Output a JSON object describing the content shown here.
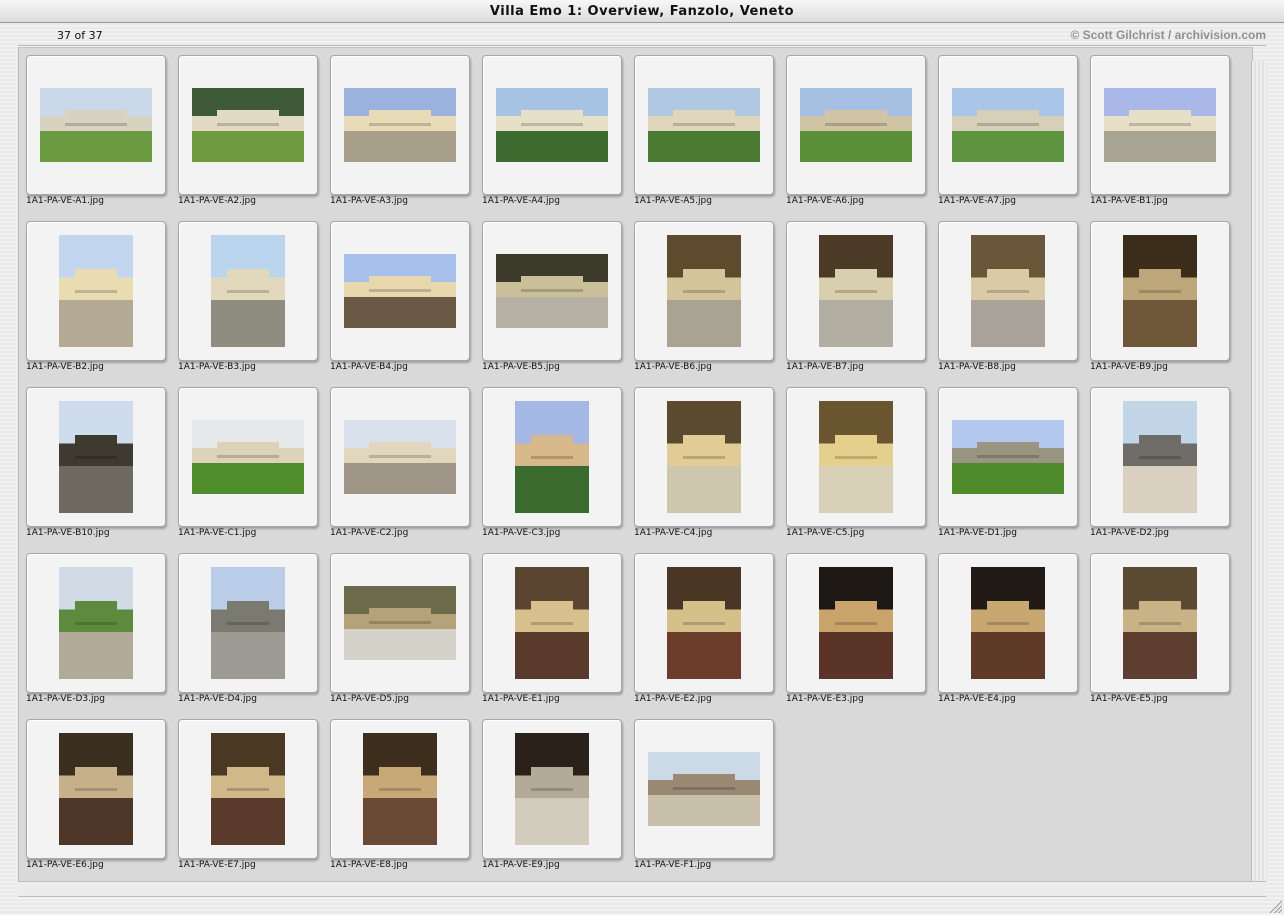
{
  "window": {
    "title": "Villa Emo 1: Overview, Fanzolo, Veneto",
    "counter": "37 of 37",
    "copyright": "© Scott Gilchrist / archivision.com"
  },
  "thumbnails": [
    {
      "file": "1A1-PA-VE-A1.jpg",
      "orientation": "landscape",
      "colors": [
        "#c9d9ea",
        "#d8d2c0",
        "#6c9a40"
      ]
    },
    {
      "file": "1A1-PA-VE-A2.jpg",
      "orientation": "landscape",
      "colors": [
        "#3e5a36",
        "#e2dac4",
        "#6f9b3e"
      ]
    },
    {
      "file": "1A1-PA-VE-A3.jpg",
      "orientation": "landscape",
      "colors": [
        "#9ab2dd",
        "#e7dbb8",
        "#a89f8a"
      ]
    },
    {
      "file": "1A1-PA-VE-A4.jpg",
      "orientation": "landscape",
      "colors": [
        "#a7c3e3",
        "#e7e0c8",
        "#3d6a2f"
      ]
    },
    {
      "file": "1A1-PA-VE-A5.jpg",
      "orientation": "landscape",
      "colors": [
        "#b0c8e2",
        "#e0d6bc",
        "#4b7a33"
      ]
    },
    {
      "file": "1A1-PA-VE-A6.jpg",
      "orientation": "landscape",
      "colors": [
        "#a6c0e3",
        "#cfc4a4",
        "#5b8f37"
      ]
    },
    {
      "file": "1A1-PA-VE-A7.jpg",
      "orientation": "landscape",
      "colors": [
        "#a9c6e8",
        "#d6d0b8",
        "#5e9340"
      ]
    },
    {
      "file": "1A1-PA-VE-B1.jpg",
      "orientation": "landscape",
      "colors": [
        "#a9b8e8",
        "#e7dfc6",
        "#a8a493"
      ]
    },
    {
      "file": "1A1-PA-VE-B2.jpg",
      "orientation": "portrait",
      "colors": [
        "#c2d7ef",
        "#e9dcb2",
        "#b5ab95"
      ]
    },
    {
      "file": "1A1-PA-VE-B3.jpg",
      "orientation": "portrait",
      "colors": [
        "#bcd5ef",
        "#e2d9bc",
        "#8f8c80"
      ]
    },
    {
      "file": "1A1-PA-VE-B4.jpg",
      "orientation": "landscape",
      "colors": [
        "#a8c0ee",
        "#e8d8ae",
        "#6a5a45"
      ]
    },
    {
      "file": "1A1-PA-VE-B5.jpg",
      "orientation": "landscape",
      "colors": [
        "#3c3a2a",
        "#c9c09a",
        "#b6b0a4"
      ]
    },
    {
      "file": "1A1-PA-VE-B6.jpg",
      "orientation": "portrait",
      "colors": [
        "#5e4a2c",
        "#d4c49a",
        "#a9a394"
      ]
    },
    {
      "file": "1A1-PA-VE-B7.jpg",
      "orientation": "portrait",
      "colors": [
        "#4a3a26",
        "#d8cfae",
        "#b3aea2"
      ]
    },
    {
      "file": "1A1-PA-VE-B8.jpg",
      "orientation": "portrait",
      "colors": [
        "#6a5638",
        "#d9cba6",
        "#a8a298"
      ]
    },
    {
      "file": "1A1-PA-VE-B9.jpg",
      "orientation": "portrait",
      "colors": [
        "#3c2c1a",
        "#bda67a",
        "#6d5738"
      ]
    },
    {
      "file": "1A1-PA-VE-B10.jpg",
      "orientation": "portrait",
      "colors": [
        "#cfdcec",
        "#3e3a30",
        "#6e6a62"
      ]
    },
    {
      "file": "1A1-PA-VE-C1.jpg",
      "orientation": "landscape",
      "colors": [
        "#e6e8ea",
        "#ddd3b8",
        "#4f8c2a"
      ]
    },
    {
      "file": "1A1-PA-VE-C2.jpg",
      "orientation": "landscape",
      "colors": [
        "#d9e2ec",
        "#e0d7bd",
        "#9f9688"
      ]
    },
    {
      "file": "1A1-PA-VE-C3.jpg",
      "orientation": "portrait",
      "colors": [
        "#a4b8e6",
        "#d6b88a",
        "#3b6a2e"
      ]
    },
    {
      "file": "1A1-PA-VE-C4.jpg",
      "orientation": "portrait",
      "colors": [
        "#5a4a30",
        "#e0cc94",
        "#cfc6ae"
      ]
    },
    {
      "file": "1A1-PA-VE-C5.jpg",
      "orientation": "portrait",
      "colors": [
        "#6a5630",
        "#e4d08c",
        "#d9d0b8"
      ]
    },
    {
      "file": "1A1-PA-VE-D1.jpg",
      "orientation": "landscape",
      "colors": [
        "#b2c8ec",
        "#9a9482",
        "#4f8a2c"
      ]
    },
    {
      "file": "1A1-PA-VE-D2.jpg",
      "orientation": "portrait",
      "colors": [
        "#c3d6e8",
        "#6e6c66",
        "#d9d0c0"
      ]
    },
    {
      "file": "1A1-PA-VE-D3.jpg",
      "orientation": "portrait",
      "colors": [
        "#d0dbe6",
        "#5d8a3c",
        "#b1aa98"
      ]
    },
    {
      "file": "1A1-PA-VE-D4.jpg",
      "orientation": "portrait",
      "colors": [
        "#b9cde8",
        "#7a7a70",
        "#9c9a92"
      ]
    },
    {
      "file": "1A1-PA-VE-D5.jpg",
      "orientation": "landscape",
      "colors": [
        "#6b6a4a",
        "#b5a27a",
        "#d2d2c8"
      ]
    },
    {
      "file": "1A1-PA-VE-E1.jpg",
      "orientation": "portrait",
      "colors": [
        "#5a4630",
        "#d8c08e",
        "#5a3a2a"
      ]
    },
    {
      "file": "1A1-PA-VE-E2.jpg",
      "orientation": "portrait",
      "colors": [
        "#4a3624",
        "#d6c08a",
        "#6a3e2a"
      ]
    },
    {
      "file": "1A1-PA-VE-E3.jpg",
      "orientation": "portrait",
      "colors": [
        "#1e1814",
        "#c8a46a",
        "#5a3426"
      ]
    },
    {
      "file": "1A1-PA-VE-E4.jpg",
      "orientation": "portrait",
      "colors": [
        "#221a14",
        "#c8a870",
        "#603a28"
      ]
    },
    {
      "file": "1A1-PA-VE-E5.jpg",
      "orientation": "portrait",
      "colors": [
        "#5a4a32",
        "#c9b386",
        "#5e3e2e"
      ]
    },
    {
      "file": "1A1-PA-VE-E6.jpg",
      "orientation": "portrait",
      "colors": [
        "#3a2e1e",
        "#c6b08a",
        "#4e3628"
      ]
    },
    {
      "file": "1A1-PA-VE-E7.jpg",
      "orientation": "portrait",
      "colors": [
        "#4a3a24",
        "#d0b888",
        "#5a3a2a"
      ]
    },
    {
      "file": "1A1-PA-VE-E8.jpg",
      "orientation": "portrait",
      "colors": [
        "#3e2e1e",
        "#c9a878",
        "#6a4a34"
      ]
    },
    {
      "file": "1A1-PA-VE-E9.jpg",
      "orientation": "portrait",
      "colors": [
        "#2a221a",
        "#b4aa98",
        "#d2ccbe"
      ]
    },
    {
      "file": "1A1-PA-VE-F1.jpg",
      "orientation": "landscape",
      "colors": [
        "#ccd9e6",
        "#9a8a74",
        "#c9c0ac"
      ]
    }
  ]
}
